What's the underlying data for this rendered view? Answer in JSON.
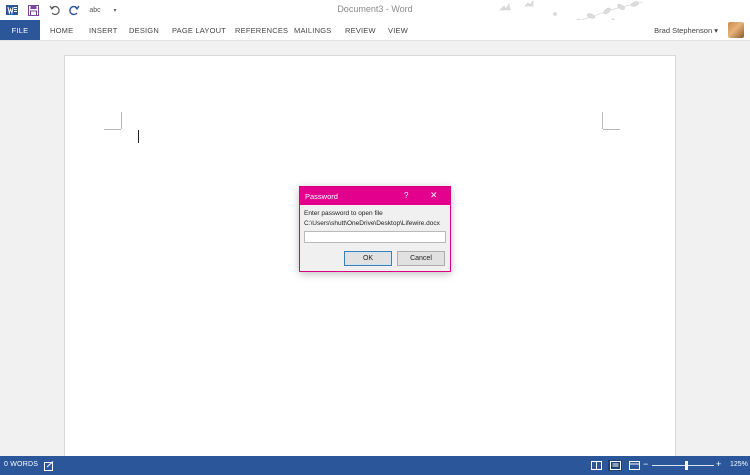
{
  "window": {
    "title": "Document3 - Word",
    "user_name": "Brad Stephenson",
    "user_name_suffix": "▾"
  },
  "quick_access": {
    "icons": [
      "word-logo-icon",
      "save-icon",
      "undo-icon",
      "redo-icon",
      "spelling-icon",
      "customize-icon"
    ],
    "spelling_label": "abc"
  },
  "ribbon": {
    "file_tab": "FILE",
    "tabs": [
      "HOME",
      "INSERT",
      "DESIGN",
      "PAGE LAYOUT",
      "REFERENCES",
      "MAILINGS",
      "REVIEW",
      "VIEW"
    ]
  },
  "dialog": {
    "title": "Password",
    "help_label": "?",
    "close_label": "✕",
    "prompt": "Enter password to open file",
    "file_path": "C:\\Users\\shutt\\OneDrive\\Desktop\\Lifewire.docx",
    "password_value": "",
    "ok_label": "OK",
    "cancel_label": "Cancel"
  },
  "status_bar": {
    "word_count": "0 WORDS",
    "zoom_minus": "−",
    "zoom_plus": "+",
    "zoom_level": "125%",
    "zoom_slider_fraction": 0.55
  },
  "colors": {
    "ribbon_blue": "#2b579a",
    "dialog_accent": "#e3008c"
  }
}
